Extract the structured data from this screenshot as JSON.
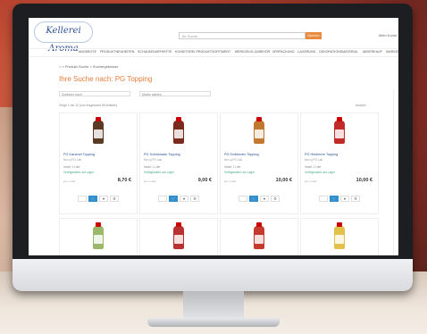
{
  "header": {
    "logo_text": "Kellerei Aroma",
    "search_placeholder": "Ihr Suche",
    "search_button": "Suchen",
    "account_label": "Mein Konto"
  },
  "nav": {
    "items": [
      "ANGEBOTE",
      "PRODUKTNEUHEITEN",
      "SCHULBEDARFHEFTE",
      "KONDITOREI-PRODUKTSORTIMENT",
      "WERKZEUG-ZUBEHÖR",
      "VERPACKUNG",
      "LAGERUNG",
      "DEKORATIONSMATERIAL",
      "ABVERKAUF",
      "MARKEN",
      "ÜBER UNS",
      "KONTAKT"
    ]
  },
  "breadcrumb": "» Produkt-Suche » Suchergebnisse",
  "page_title": "Ihre Suche nach: PG Topping",
  "filters": {
    "sort_label": "Sortieren nach",
    "filter_label": "Marke wählen"
  },
  "result_info": "Zeige 1 bis 12 (von insgesamt 38 Artikeln)",
  "view_options": "Ansicht",
  "products": [
    {
      "name": "PG Karamel Topping",
      "brand": "Nor-sj PG Lab",
      "content": "Inhalt: 1 Liter",
      "availability": "Verfügbarkeit: auf Lager",
      "price": "8,70 €",
      "per_unit": "pro 1 Liter",
      "color": "#5a3a22"
    },
    {
      "name": "PG Schokolade Topping",
      "brand": "Nor-sj PG Lab",
      "content": "Inhalt: 1 Liter",
      "availability": "Verfügbarkeit: auf Lager",
      "price": "9,00 €",
      "per_unit": "pro 1 Liter",
      "color": "#7a2b1e"
    },
    {
      "name": "PG Erdbeeren Topping",
      "brand": "Nor-sj PG Lab",
      "content": "Inhalt: 1 Liter",
      "availability": "Verfügbarkeit: auf Lager",
      "price": "10,00 €",
      "per_unit": "pro 1 Liter",
      "color": "#c0792e"
    },
    {
      "name": "PG Himbeere Topping",
      "brand": "Nor-sj PG Lab",
      "content": "Inhalt: 1 Liter",
      "availability": "Verfügbarkeit: auf Lager",
      "price": "10,00 €",
      "per_unit": "pro 1 Liter",
      "color": "#c22a2a"
    },
    {
      "name": "",
      "brand": "",
      "content": "",
      "availability": "",
      "price": "",
      "per_unit": "",
      "color": "#9bb86a"
    },
    {
      "name": "",
      "brand": "",
      "content": "",
      "availability": "",
      "price": "",
      "per_unit": "",
      "color": "#b83232"
    },
    {
      "name": "",
      "brand": "",
      "content": "",
      "availability": "",
      "price": "",
      "per_unit": "",
      "color": "#c43b2e"
    },
    {
      "name": "",
      "brand": "",
      "content": "",
      "availability": "",
      "price": "",
      "per_unit": "",
      "color": "#e2c14a"
    }
  ]
}
